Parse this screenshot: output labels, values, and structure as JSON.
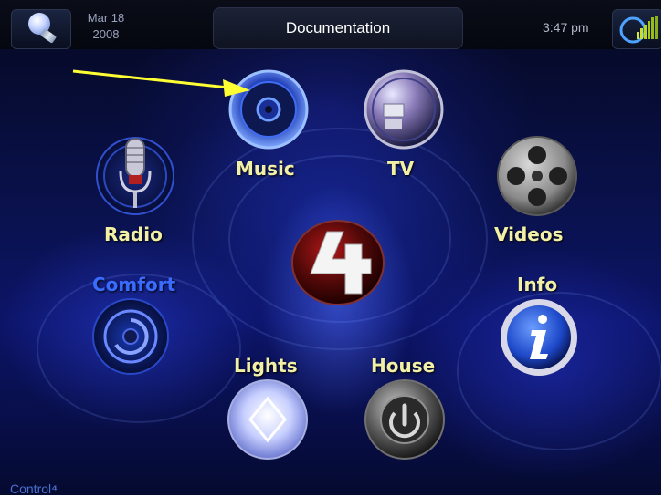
{
  "header": {
    "date_line1": "Mar 18",
    "date_line2": "2008",
    "title": "Documentation",
    "time": "3:47 pm"
  },
  "menu": {
    "music": "Music",
    "tv": "TV",
    "radio": "Radio",
    "videos": "Videos",
    "comfort": "Comfort",
    "info": "Info",
    "lights": "Lights",
    "house": "House"
  },
  "footer": {
    "brand": "Control"
  },
  "icons": {
    "home": "light-bulb-icon",
    "settings": "signal-strength-icon",
    "music": "speaker-icon",
    "tv": "tv-icon",
    "radio": "microphone-icon",
    "videos": "film-reel-icon",
    "comfort": "thermostat-icon",
    "info": "info-icon",
    "lights": "light-diamond-icon",
    "house": "house-power-icon",
    "logo": "control4-logo-icon"
  },
  "colors": {
    "label": "#f2f0a6",
    "label_comfort": "#3a6bff",
    "annotation_arrow": "#ffff33"
  }
}
